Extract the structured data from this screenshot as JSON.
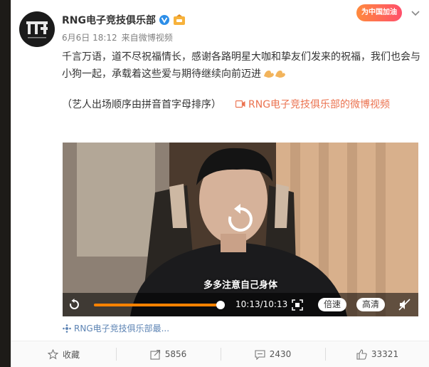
{
  "post": {
    "author": "RNG电子竞技俱乐部",
    "date": "6月6日 18:12",
    "source_prefix": "来自",
    "source_app": "微博视频",
    "text": "千言万语，道不尽祝福情长，感谢各路明星大咖和挚友们发来的祝福，我们也会与小狗一起，承载着这些爱与期待继续向前迈进",
    "extra_note": "（艺人出场顺序由拼音首字母排序）",
    "video_link": "RNG电子竞技俱乐部的微博视频",
    "campaign_badge": "为中国加油"
  },
  "video": {
    "subtitle": "多多注意自己身体",
    "time": "10:13/10:13",
    "progress": 1.0,
    "speed_label": "倍速",
    "quality_label": "高清",
    "source_label": "RNG电子竞技俱乐部最..."
  },
  "actions": {
    "favorite": "收藏",
    "repost": "5856",
    "comment": "2430",
    "like": "33321"
  },
  "colors": {
    "accent": "#ff8200",
    "link": "#eb7350",
    "source": "#5d84b4"
  },
  "icons": [
    "verified-icon",
    "member-medal-icon",
    "caret-down-icon",
    "video-icon",
    "replay-icon",
    "fullscreen-icon",
    "mute-icon",
    "star-icon",
    "repost-icon",
    "comment-icon",
    "like-icon"
  ]
}
